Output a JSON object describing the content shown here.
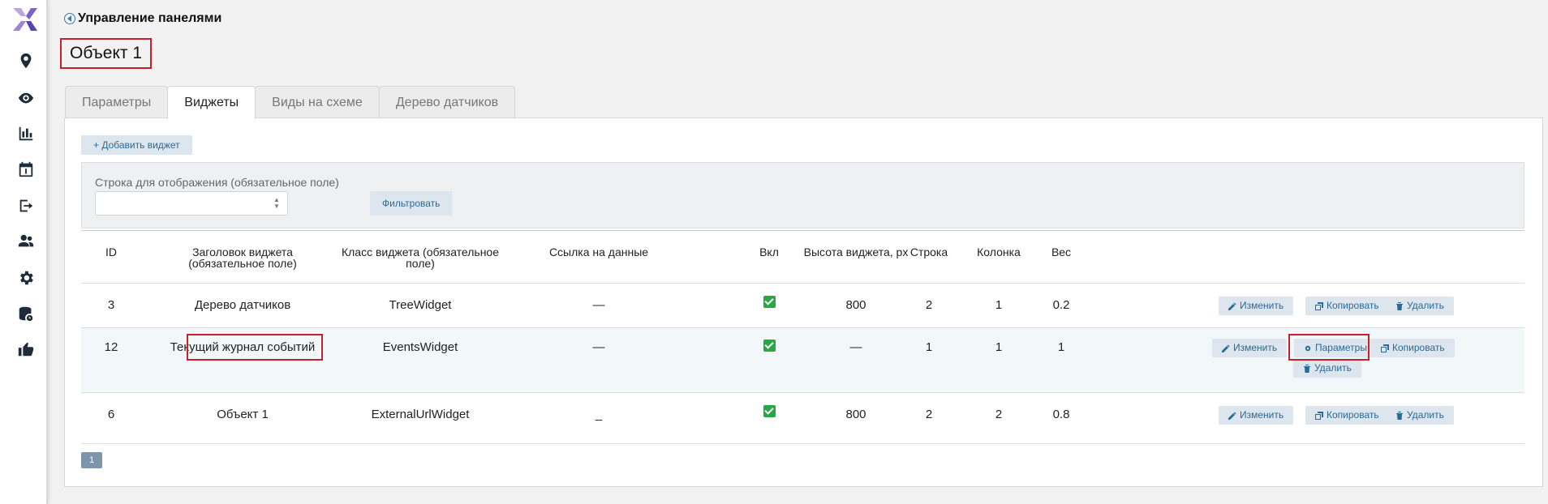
{
  "page": {
    "title": "Управление панелями",
    "object_title": "Объект 1"
  },
  "tabs": [
    {
      "label": "Параметры"
    },
    {
      "label": "Виджеты",
      "active": true
    },
    {
      "label": "Виды на схеме"
    },
    {
      "label": "Дерево датчиков"
    }
  ],
  "toolbar": {
    "add_widget_label": "+ Добавить виджет"
  },
  "filter": {
    "label": "Строка для отображения (обязательное поле)",
    "value": "",
    "button_label": "Фильтровать"
  },
  "table": {
    "columns": [
      "ID",
      "Заголовок виджета (обязательное поле)",
      "Класс виджета (обязательное поле)",
      "Ссылка на данные",
      "Вкл",
      "Высота виджета, px",
      "Строка",
      "Колонка",
      "Вес"
    ],
    "rows": [
      {
        "id": "3",
        "title": "Дерево датчиков",
        "class": "TreeWidget",
        "link": "—",
        "enabled": true,
        "height": "800",
        "row": "2",
        "col": "1",
        "weight": "0.2"
      },
      {
        "id": "12",
        "title": "Текущий журнал событий",
        "class": "EventsWidget",
        "link": "—",
        "enabled": true,
        "height": "—",
        "row": "1",
        "col": "1",
        "weight": "1"
      },
      {
        "id": "6",
        "title": "Объект 1",
        "class": "ExternalUrlWidget",
        "link": "_",
        "enabled": true,
        "height": "800",
        "row": "2",
        "col": "2",
        "weight": "0.8"
      }
    ],
    "actions": {
      "edit": "Изменить",
      "params": "Параметры",
      "copy": "Копировать",
      "delete": "Удалить"
    }
  },
  "pager": {
    "current": "1"
  },
  "colors": {
    "accent": "#2a6a94",
    "highlight": "#c8202a",
    "check": "#28a745"
  }
}
